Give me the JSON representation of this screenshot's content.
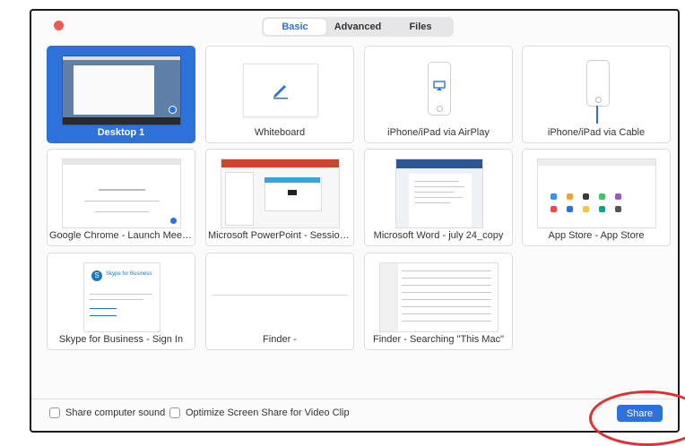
{
  "window": {
    "close_color": "#ee5a52"
  },
  "tabs": [
    {
      "label": "Basic",
      "active": true
    },
    {
      "label": "Advanced",
      "active": false
    },
    {
      "label": "Files",
      "active": false
    }
  ],
  "tiles": [
    {
      "label": "Desktop 1",
      "selected": true,
      "icon": "desktop-thumbnail"
    },
    {
      "label": "Whiteboard",
      "selected": false,
      "icon": "pen-icon"
    },
    {
      "label": "iPhone/iPad via AirPlay",
      "selected": false,
      "icon": "airplay-icon"
    },
    {
      "label": "iPhone/iPad via Cable",
      "selected": false,
      "icon": "cable-icon"
    },
    {
      "label": "Google Chrome - Launch Meeting...",
      "selected": false
    },
    {
      "label": "Microsoft PowerPoint - Session 3_...",
      "selected": false
    },
    {
      "label": "Microsoft Word - july 24_copy",
      "selected": false
    },
    {
      "label": "App Store - App Store",
      "selected": false
    },
    {
      "label": "Skype for Business - Sign In",
      "selected": false
    },
    {
      "label": "Finder -",
      "selected": false
    },
    {
      "label": "Finder - Searching \"This Mac\"",
      "selected": false
    }
  ],
  "thumb_text": {
    "skype_title": "Skype for Business"
  },
  "footer": {
    "share_sound": "Share computer sound",
    "optimize": "Optimize Screen Share for Video Clip",
    "share_button": "Share"
  },
  "colors": {
    "accent": "#2d71db",
    "annotation": "#e52e2e"
  }
}
